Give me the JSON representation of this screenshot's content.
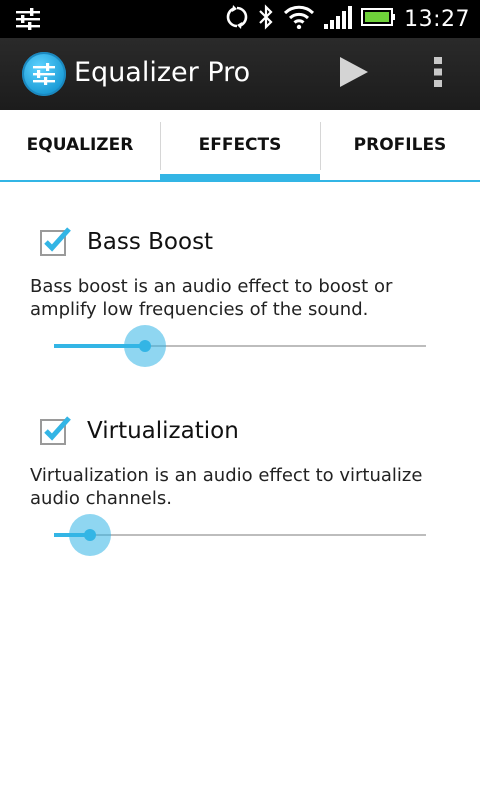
{
  "status_bar": {
    "time": "13:27",
    "icons": [
      "equalizer-icon",
      "sync-icon",
      "bluetooth-icon",
      "wifi-icon",
      "signal-icon",
      "battery-icon"
    ]
  },
  "action_bar": {
    "title": "Equalizer Pro",
    "icons": [
      "app-equalizer-icon",
      "play-icon",
      "overflow-menu-icon"
    ]
  },
  "tabs": [
    {
      "label": "EQUALIZER",
      "active": false
    },
    {
      "label": "EFFECTS",
      "active": true
    },
    {
      "label": "PROFILES",
      "active": false
    }
  ],
  "effects": [
    {
      "title": "Bass Boost",
      "checked": true,
      "description": "Bass boost is an audio effect to boost or amplify low frequencies of the sound.",
      "level": 0.245
    },
    {
      "title": "Virtualization",
      "checked": true,
      "description": "Virtualization is an audio effect to virtualize audio channels.",
      "level": 0.097
    }
  ],
  "colors": {
    "accent": "#33b5e5",
    "action_bar": "#222222",
    "status_bar": "#000000",
    "battery": "#6fd13a"
  }
}
